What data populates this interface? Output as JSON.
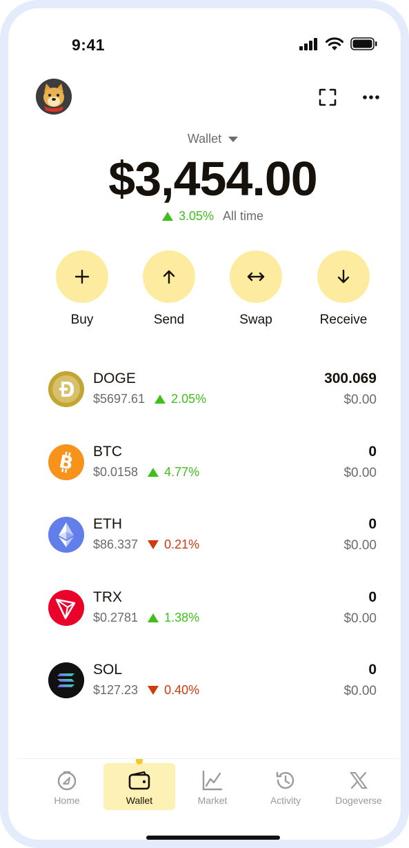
{
  "status_bar": {
    "time": "9:41",
    "icons": [
      "signal-icon",
      "wifi-icon",
      "battery-icon"
    ]
  },
  "header": {
    "avatar": "doge-avatar",
    "scan_icon": "scan-icon",
    "more_icon": "more-icon"
  },
  "wallet": {
    "selector_label": "Wallet",
    "balance": "$3,454.00",
    "change_percent": "3.05%",
    "change_period": "All time"
  },
  "actions": [
    {
      "label": "Buy",
      "icon": "plus-icon"
    },
    {
      "label": "Send",
      "icon": "arrow-up-icon"
    },
    {
      "label": "Swap",
      "icon": "swap-icon"
    },
    {
      "label": "Receive",
      "icon": "arrow-down-icon"
    }
  ],
  "assets": [
    {
      "symbol": "DOGE",
      "price": "$5697.61",
      "change": "2.05%",
      "direction": "up",
      "amount": "300.069",
      "value": "$0.00",
      "icon": "doge-coin-icon"
    },
    {
      "symbol": "BTC",
      "price": "$0.0158",
      "change": "4.77%",
      "direction": "up",
      "amount": "0",
      "value": "$0.00",
      "icon": "bitcoin-icon"
    },
    {
      "symbol": "ETH",
      "price": "$86.337",
      "change": "0.21%",
      "direction": "down",
      "amount": "0",
      "value": "$0.00",
      "icon": "ethereum-icon"
    },
    {
      "symbol": "TRX",
      "price": "$0.2781",
      "change": "1.38%",
      "direction": "up",
      "amount": "0",
      "value": "$0.00",
      "icon": "tron-icon"
    },
    {
      "symbol": "SOL",
      "price": "$127.23",
      "change": "0.40%",
      "direction": "down",
      "amount": "0",
      "value": "$0.00",
      "icon": "solana-icon"
    }
  ],
  "nav": [
    {
      "label": "Home",
      "icon": "home-icon",
      "active": false
    },
    {
      "label": "Wallet",
      "icon": "wallet-icon",
      "active": true
    },
    {
      "label": "Market",
      "icon": "market-chart-icon",
      "active": false
    },
    {
      "label": "Activity",
      "icon": "activity-history-icon",
      "active": false
    },
    {
      "label": "Dogeverse",
      "icon": "x-logo-icon",
      "active": false
    }
  ],
  "colors": {
    "accent_yellow": "#fdec9f",
    "nav_active_bg": "#fdf1b5",
    "up_green": "#3fbf1a",
    "down_red": "#d0380d",
    "frame": "#e4ecfb"
  }
}
